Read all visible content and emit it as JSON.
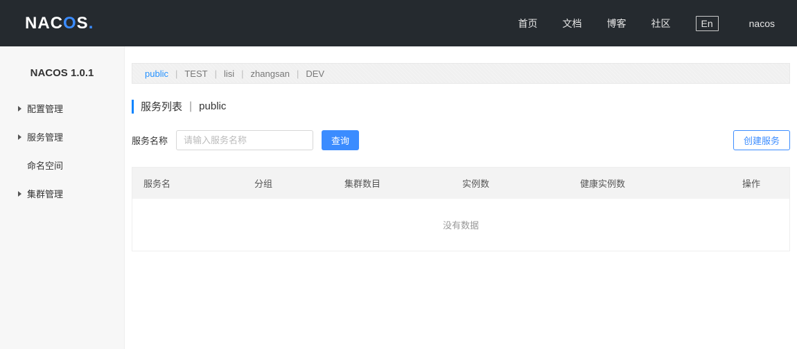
{
  "header": {
    "logo_prefix": "NAC",
    "logo_accent": "O",
    "logo_suffix": "S",
    "logo_dot": ".",
    "nav": [
      "首页",
      "文档",
      "博客",
      "社区"
    ],
    "lang": "En",
    "user": "nacos"
  },
  "sidebar": {
    "version": "NACOS 1.0.1",
    "items": [
      {
        "label": "配置管理",
        "caret": true
      },
      {
        "label": "服务管理",
        "caret": true
      },
      {
        "label": "命名空间",
        "caret": false
      },
      {
        "label": "集群管理",
        "caret": true
      }
    ]
  },
  "namespaces": [
    {
      "label": "public",
      "active": true
    },
    {
      "label": "TEST",
      "active": false
    },
    {
      "label": "lisi",
      "active": false
    },
    {
      "label": "zhangsan",
      "active": false
    },
    {
      "label": "DEV",
      "active": false
    }
  ],
  "page": {
    "title": "服务列表",
    "ns": "public"
  },
  "filter": {
    "label": "服务名称",
    "placeholder": "请输入服务名称",
    "search_btn": "查询",
    "create_btn": "创建服务"
  },
  "table": {
    "columns": [
      "服务名",
      "分组",
      "集群数目",
      "实例数",
      "健康实例数",
      "操作"
    ],
    "empty": "没有数据"
  }
}
